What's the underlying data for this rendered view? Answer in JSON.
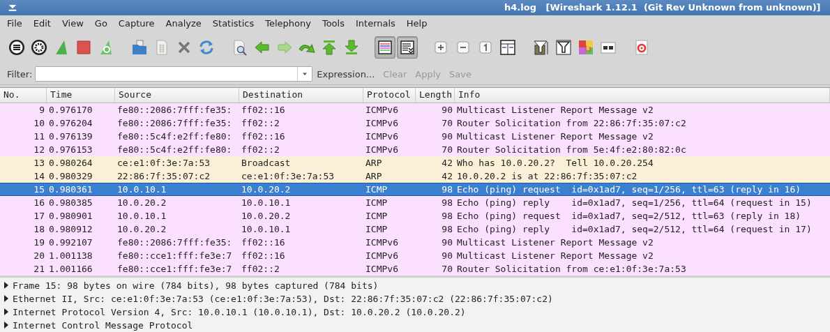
{
  "window": {
    "title": "h4.log   [Wireshark 1.12.1  (Git Rev Unknown from unknown)]"
  },
  "menu": [
    "File",
    "Edit",
    "View",
    "Go",
    "Capture",
    "Analyze",
    "Statistics",
    "Telephony",
    "Tools",
    "Internals",
    "Help"
  ],
  "toolbar_toggles": [
    {
      "pressed": true
    },
    {
      "pressed": true
    }
  ],
  "filter": {
    "label": "Filter:",
    "buttons": [
      {
        "label": "Expression...",
        "disabled": false
      },
      {
        "label": "Clear",
        "disabled": true
      },
      {
        "label": "Apply",
        "disabled": true
      },
      {
        "label": "Save",
        "disabled": true
      }
    ]
  },
  "table": {
    "columns": [
      "No.",
      "Time",
      "Source",
      "Destination",
      "Protocol",
      "Length",
      "Info"
    ],
    "rows": [
      {
        "cells": [
          "9",
          "0.976170",
          "fe80::2086:7fff:fe35:",
          "ff02::16",
          "ICMPv6",
          "90",
          "Multicast Listener Report Message v2"
        ],
        "color": "#fce0ff",
        "selected": false
      },
      {
        "cells": [
          "10",
          "0.976204",
          "fe80::2086:7fff:fe35:",
          "ff02::2",
          "ICMPv6",
          "70",
          "Router Solicitation from 22:86:7f:35:07:c2"
        ],
        "color": "#fce0ff",
        "selected": false
      },
      {
        "cells": [
          "11",
          "0.976139",
          "fe80::5c4f:e2ff:fe80:",
          "ff02::16",
          "ICMPv6",
          "90",
          "Multicast Listener Report Message v2"
        ],
        "color": "#fce0ff",
        "selected": false
      },
      {
        "cells": [
          "12",
          "0.976153",
          "fe80::5c4f:e2ff:fe80:",
          "ff02::2",
          "ICMPv6",
          "70",
          "Router Solicitation from 5e:4f:e2:80:82:0c"
        ],
        "color": "#fce0ff",
        "selected": false
      },
      {
        "cells": [
          "13",
          "0.980264",
          "ce:e1:0f:3e:7a:53",
          "Broadcast",
          "ARP",
          "42",
          "Who has 10.0.20.2?  Tell 10.0.20.254"
        ],
        "color": "#faf0d7",
        "selected": false
      },
      {
        "cells": [
          "14",
          "0.980329",
          "22:86:7f:35:07:c2",
          "ce:e1:0f:3e:7a:53",
          "ARP",
          "42",
          "10.0.20.2 is at 22:86:7f:35:07:c2"
        ],
        "color": "#faf0d7",
        "selected": false
      },
      {
        "cells": [
          "15",
          "0.980361",
          "10.0.10.1",
          "10.0.20.2",
          "ICMP",
          "98",
          "Echo (ping) request  id=0x1ad7, seq=1/256, ttl=63 (reply in 16)"
        ],
        "color": "#3a7fd0",
        "selected": true
      },
      {
        "cells": [
          "16",
          "0.980385",
          "10.0.20.2",
          "10.0.10.1",
          "ICMP",
          "98",
          "Echo (ping) reply    id=0x1ad7, seq=1/256, ttl=64 (request in 15)"
        ],
        "color": "#fce0ff",
        "selected": false
      },
      {
        "cells": [
          "17",
          "0.980901",
          "10.0.10.1",
          "10.0.20.2",
          "ICMP",
          "98",
          "Echo (ping) request  id=0x1ad7, seq=2/512, ttl=63 (reply in 18)"
        ],
        "color": "#fce0ff",
        "selected": false
      },
      {
        "cells": [
          "18",
          "0.980912",
          "10.0.20.2",
          "10.0.10.1",
          "ICMP",
          "98",
          "Echo (ping) reply    id=0x1ad7, seq=2/512, ttl=64 (request in 17)"
        ],
        "color": "#fce0ff",
        "selected": false
      },
      {
        "cells": [
          "19",
          "0.992107",
          "fe80::2086:7fff:fe35:",
          "ff02::16",
          "ICMPv6",
          "90",
          "Multicast Listener Report Message v2"
        ],
        "color": "#fce0ff",
        "selected": false
      },
      {
        "cells": [
          "20",
          "1.001138",
          "fe80::cce1:fff:fe3e:7",
          "ff02::16",
          "ICMPv6",
          "90",
          "Multicast Listener Report Message v2"
        ],
        "color": "#fce0ff",
        "selected": false
      },
      {
        "cells": [
          "21",
          "1.001166",
          "fe80::cce1:fff:fe3e:7",
          "ff02::2",
          "ICMPv6",
          "70",
          "Router Solicitation from ce:e1:0f:3e:7a:53"
        ],
        "color": "#fce0ff",
        "selected": false
      }
    ]
  },
  "details": [
    {
      "label": "Frame 15: 98 bytes on wire (784 bits), 98 bytes captured (784 bits)",
      "expanded": false
    },
    {
      "label": "Ethernet II, Src: ce:e1:0f:3e:7a:53 (ce:e1:0f:3e:7a:53), Dst: 22:86:7f:35:07:c2 (22:86:7f:35:07:c2)",
      "expanded": false
    },
    {
      "label": "Internet Protocol Version 4, Src: 10.0.10.1 (10.0.10.1), Dst: 10.0.20.2 (10.0.20.2)",
      "expanded": false
    },
    {
      "label": "Internet Control Message Protocol",
      "expanded": false
    }
  ]
}
